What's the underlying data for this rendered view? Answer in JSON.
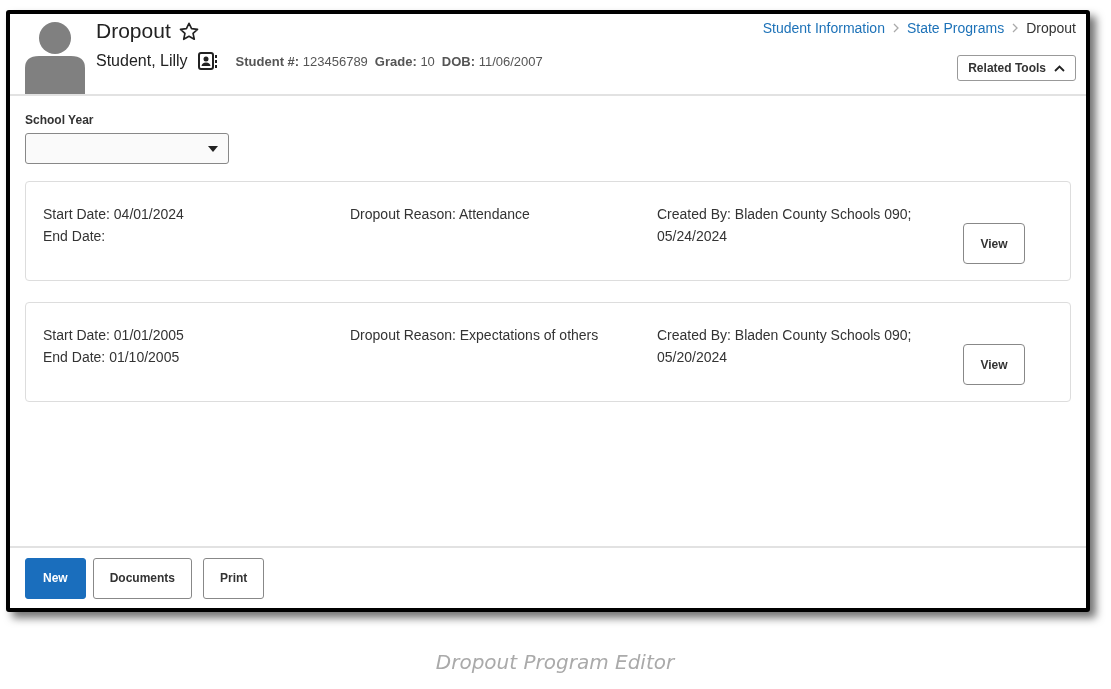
{
  "page": {
    "title": "Dropout",
    "favorite": false
  },
  "student": {
    "name": "Student, Lilly",
    "fields": [
      {
        "label": "Student #:",
        "value": "123456789"
      },
      {
        "label": "Grade:",
        "value": "10"
      },
      {
        "label": "DOB:",
        "value": "11/06/2007"
      }
    ]
  },
  "breadcrumb": [
    {
      "label": "Student Information",
      "link": true
    },
    {
      "label": "State Programs",
      "link": true
    },
    {
      "label": "Dropout",
      "link": false
    }
  ],
  "related_tools": {
    "label": "Related Tools",
    "expanded": true
  },
  "school_year": {
    "label": "School Year"
  },
  "records": [
    {
      "start": "Start Date: 04/01/2024",
      "end": "End Date:",
      "reason": "Dropout Reason: Attendance",
      "created": "Created By: Bladen County Schools 090;",
      "created_date": "05/24/2024",
      "action": "View"
    },
    {
      "start": "Start Date: 01/01/2005",
      "end": "End Date: 01/10/2005",
      "reason": "Dropout Reason: Expectations of others",
      "created": "Created By: Bladen County Schools 090;",
      "created_date": "05/20/2024",
      "action": "View"
    }
  ],
  "buttons": [
    {
      "label": "New",
      "primary": true
    },
    {
      "label": "Documents",
      "primary": false
    },
    {
      "label": "Print",
      "primary": false
    }
  ],
  "caption": "Dropout Program Editor"
}
